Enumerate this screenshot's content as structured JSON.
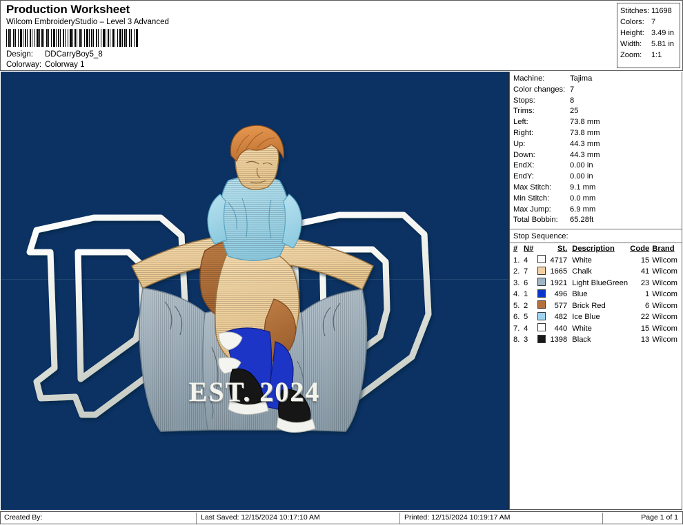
{
  "header": {
    "title": "Production Worksheet",
    "subtitle": "Wilcom EmbroideryStudio – Level 3 Advanced",
    "design_label": "Design:",
    "design_value": "DDCarryBoy5_8",
    "colorway_label": "Colorway:",
    "colorway_value": "Colorway 1"
  },
  "summary": {
    "rows": [
      {
        "label": "Stitches:",
        "value": "11698"
      },
      {
        "label": "Colors:",
        "value": "7"
      },
      {
        "label": "Height:",
        "value": "3.49 in"
      },
      {
        "label": "Width:",
        "value": "5.81 in"
      },
      {
        "label": "Zoom:",
        "value": "1:1"
      }
    ]
  },
  "canvas": {
    "background_color": "#0b3263",
    "est_text": "EST. 2024",
    "letters": [
      "D",
      "D"
    ],
    "artwork_description": "Embroidered DAD design with boy carried on shoulders"
  },
  "machine_info": {
    "rows": [
      {
        "label": "Machine:",
        "value": "Tajima"
      },
      {
        "label": "Color changes:",
        "value": "7"
      },
      {
        "label": "Stops:",
        "value": "8"
      },
      {
        "label": "Trims:",
        "value": "25"
      },
      {
        "label": "Left:",
        "value": "73.8 mm"
      },
      {
        "label": "Right:",
        "value": "73.8 mm"
      },
      {
        "label": "Up:",
        "value": "44.3 mm"
      },
      {
        "label": "Down:",
        "value": "44.3 mm"
      },
      {
        "label": "EndX:",
        "value": "0.00 in"
      },
      {
        "label": "EndY:",
        "value": "0.00 in"
      },
      {
        "label": "Max Stitch:",
        "value": "9.1 mm"
      },
      {
        "label": "Min Stitch:",
        "value": "0.0 mm"
      },
      {
        "label": "Max Jump:",
        "value": "6.9 mm"
      },
      {
        "label": "Total Bobbin:",
        "value": "65.28ft"
      }
    ]
  },
  "stop_sequence": {
    "title": "Stop Sequence:",
    "columns": [
      "#",
      "N#",
      "St.",
      "Description",
      "Code",
      "Brand"
    ],
    "rows": [
      {
        "num": "1.",
        "needle": "4",
        "color": "#fdfdfd",
        "stitches": "4717",
        "description": "White",
        "code": "15",
        "brand": "Wilcom"
      },
      {
        "num": "2.",
        "needle": "7",
        "color": "#f2cfa4",
        "stitches": "1665",
        "description": "Chalk",
        "code": "41",
        "brand": "Wilcom"
      },
      {
        "num": "3.",
        "needle": "6",
        "color": "#9fb4c4",
        "stitches": "1921",
        "description": "Light BlueGreen",
        "code": "23",
        "brand": "Wilcom"
      },
      {
        "num": "4.",
        "needle": "1",
        "color": "#0a36c8",
        "stitches": "496",
        "description": "Blue",
        "code": "1",
        "brand": "Wilcom"
      },
      {
        "num": "5.",
        "needle": "2",
        "color": "#b3703c",
        "stitches": "577",
        "description": "Brick Red",
        "code": "6",
        "brand": "Wilcom"
      },
      {
        "num": "6.",
        "needle": "5",
        "color": "#9fd3f0",
        "stitches": "482",
        "description": "Ice Blue",
        "code": "22",
        "brand": "Wilcom"
      },
      {
        "num": "7.",
        "needle": "4",
        "color": "#fdfdfd",
        "stitches": "440",
        "description": "White",
        "code": "15",
        "brand": "Wilcom"
      },
      {
        "num": "8.",
        "needle": "3",
        "color": "#171717",
        "stitches": "1398",
        "description": "Black",
        "code": "13",
        "brand": "Wilcom"
      }
    ]
  },
  "footer": {
    "created_by": "Created By:",
    "last_saved": "Last Saved: 12/15/2024 10:17:10 AM",
    "printed": "Printed: 12/15/2024 10:19:17 AM",
    "page": "Page 1 of 1"
  }
}
